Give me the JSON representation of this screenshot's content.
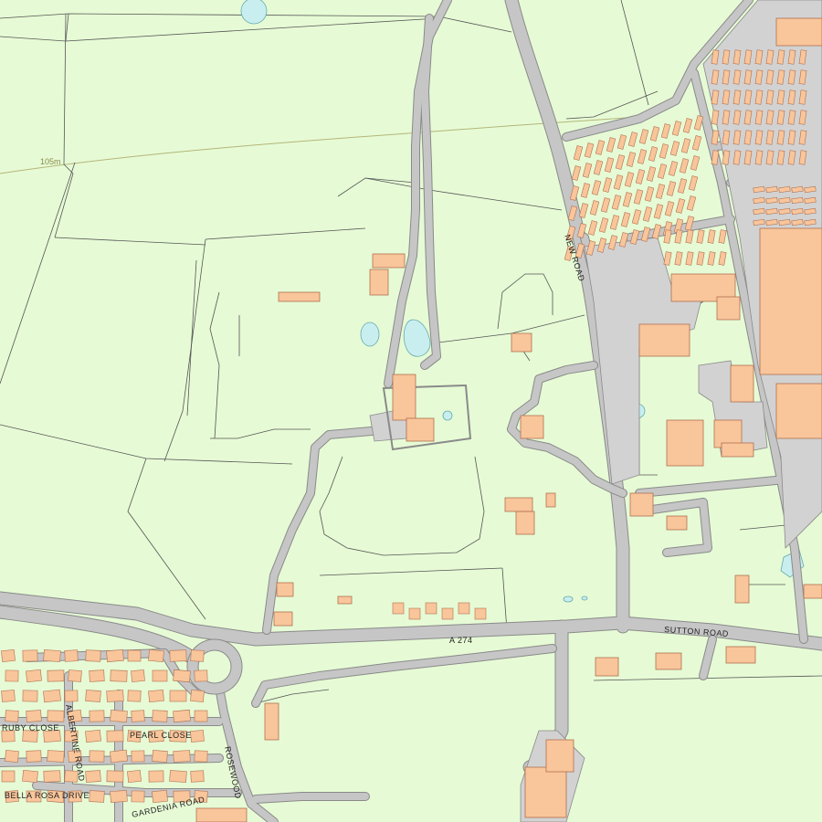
{
  "map": {
    "colors": {
      "land": "#e6fbd5",
      "road": "#c6c6c6",
      "road_edge": "#8a8a8a",
      "building": "#f9c59a",
      "building_edge": "#b07050",
      "water": "#c9eef0",
      "field_line": "#555555",
      "contour": "#b5b57a"
    },
    "labels": {
      "contour_105": "105m",
      "new_road": "NEW ROAD",
      "a274": "A 274",
      "sutton_road": "SUTTON ROAD",
      "ruby_close": "RUBY CLOSE",
      "albertine_road": "ALBERTINE ROAD",
      "pearl_close": "PEARL CLOSE",
      "rosewood": "ROSEWOOD",
      "bella_rosa_drive": "BELLA ROSA DRIVE",
      "gardenia_road": "GARDENIA ROAD"
    }
  }
}
